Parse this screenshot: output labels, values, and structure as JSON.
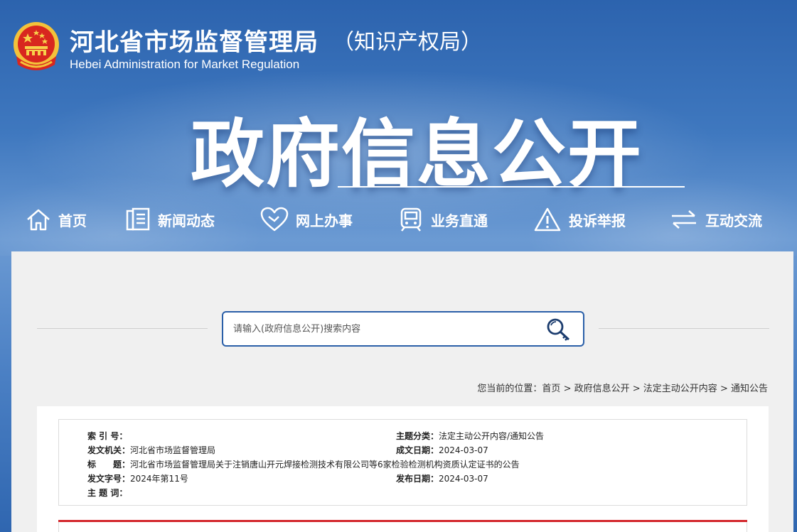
{
  "header": {
    "site_name": "河北省市场监督管理局",
    "site_subname": "（知识产权局）",
    "site_name_en": "Hebei Administration for Market Regulation",
    "banner_title": "政府信息公开"
  },
  "nav": {
    "items": [
      {
        "label": "首页",
        "icon": "home-icon"
      },
      {
        "label": "新闻动态",
        "icon": "news-icon"
      },
      {
        "label": "网上办事",
        "icon": "heart-icon"
      },
      {
        "label": "业务直通",
        "icon": "train-icon"
      },
      {
        "label": "投诉举报",
        "icon": "warning-icon"
      },
      {
        "label": "互动交流",
        "icon": "exchange-icon"
      }
    ]
  },
  "search": {
    "placeholder": "请输入(政府信息公开)搜索内容",
    "icon": "search-key-icon"
  },
  "breadcrumb": {
    "prefix": "您当前的位置：",
    "items": [
      "首页",
      "政府信息公开",
      "法定主动公开内容",
      "通知公告"
    ],
    "separator": " > "
  },
  "meta": {
    "index_label": "索 引 号：",
    "index_value": "",
    "issuer_label": "发文机关：",
    "issuer_value": "河北省市场监督管理局",
    "title_label": "标　　题：",
    "title_value": "河北省市场监督管理局关于注销唐山开元焊接检测技术有限公司等6家检验检测机构资质认定证书的公告",
    "docno_label": "发文字号：",
    "docno_value": "2024年第11号",
    "keywords_label": "主 题 词：",
    "keywords_value": "",
    "category_label": "主题分类：",
    "category_value": "法定主动公开内容/通知公告",
    "created_label": "成文日期：",
    "created_value": "2024-03-07",
    "published_label": "发布日期：",
    "published_value": "2024-03-07"
  },
  "colors": {
    "accent": "#2a5fa8",
    "red_rule": "#d3262b",
    "panel_bg": "#f0f0f0"
  }
}
